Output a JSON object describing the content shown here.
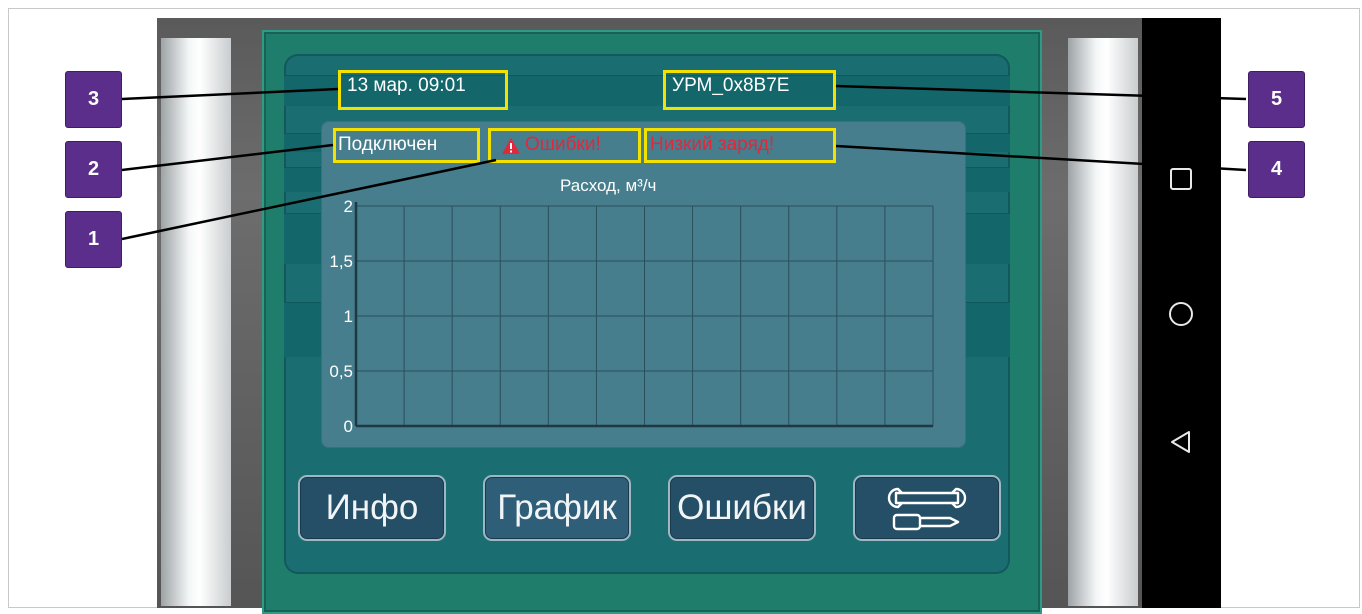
{
  "status": {
    "datetime": "13 мар. 09:01",
    "device_id": "УРМ_0x8B7E",
    "connection": "Подключен",
    "errors_flag": "Ошибки!",
    "errors_icon": "warning-triangle-icon",
    "battery_warning": "Низкий заряд!"
  },
  "chart_data": {
    "type": "line",
    "title": "Расход, м³/ч",
    "ylim": [
      0,
      2
    ],
    "yticks": [
      "0",
      "0,5",
      "1",
      "1,5",
      "2"
    ],
    "grid": true,
    "x_divisions": 12,
    "series": []
  },
  "buttons": {
    "info": "Инфо",
    "chart": "График",
    "errors": "Ошибки",
    "settings_icon": "tools-icon"
  },
  "annotations": [
    "1",
    "2",
    "3",
    "4",
    "5"
  ],
  "colors": {
    "highlight": "#f3e100",
    "label_bg": "#5b2e8c",
    "error_text": "#e0283c",
    "panel": "#467e8e"
  },
  "nav": [
    "square-recent-apps-icon",
    "circle-home-icon",
    "triangle-back-icon"
  ]
}
